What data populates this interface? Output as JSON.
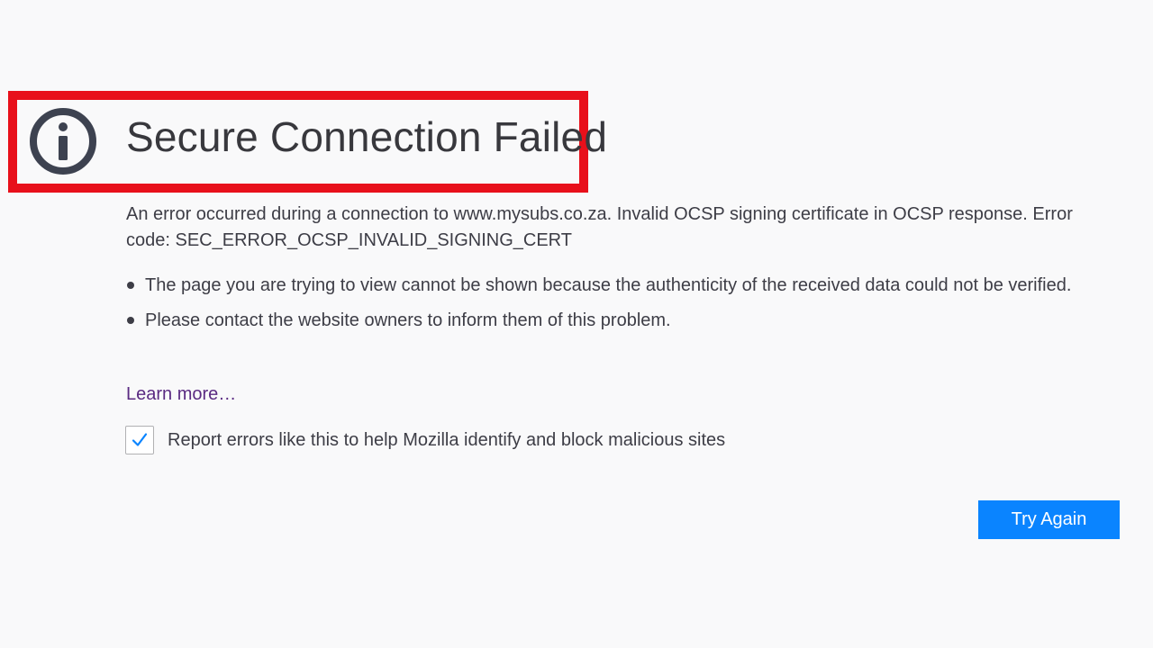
{
  "error_page": {
    "title": "Secure Connection Failed",
    "description": "An error occurred during a connection to www.mysubs.co.za. Invalid OCSP signing certificate in OCSP response. Error code: SEC_ERROR_OCSP_INVALID_SIGNING_CERT",
    "bullets": [
      "The page you are trying to view cannot be shown because the authenticity of the received data could not be verified.",
      "Please contact the website owners to inform them of this problem."
    ],
    "learn_more_label": "Learn more…",
    "report_checkbox": {
      "checked": true,
      "label": "Report errors like this to help Mozilla identify and block malicious sites"
    },
    "try_again_label": "Try Again"
  },
  "icons": {
    "title_icon": "info-icon",
    "checkbox_mark": "checkmark-icon"
  },
  "colors": {
    "background": "#f9f9fa",
    "highlight_border": "#e8101b",
    "icon": "#3d4250",
    "button": "#0a84ff",
    "link": "#5a2a82",
    "checkmark": "#0a84ff"
  }
}
